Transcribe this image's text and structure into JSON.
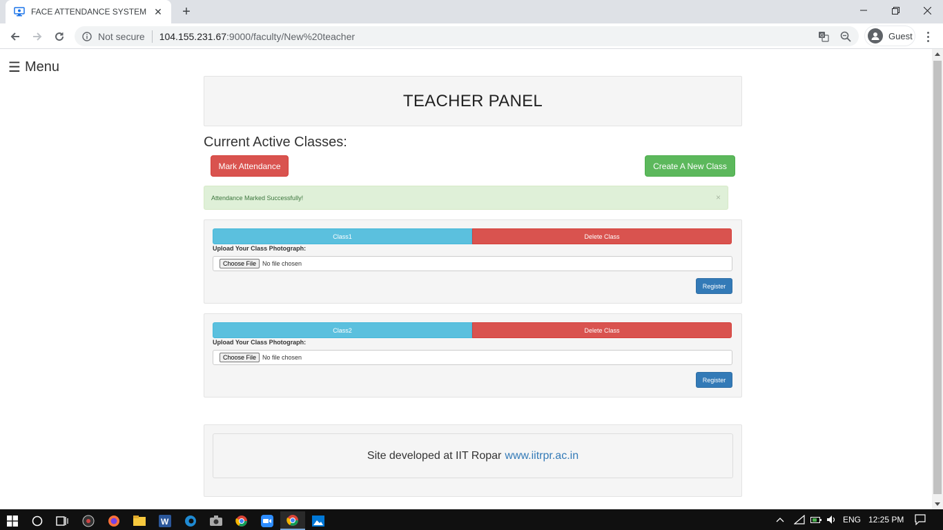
{
  "browser": {
    "tab_title": "FACE ATTENDANCE SYSTEM",
    "security_text": "Not secure",
    "url_host": "104.155.231.67",
    "url_path": ":9000/faculty/New%20teacher",
    "profile_label": "Guest"
  },
  "page": {
    "menu_label": "Menu",
    "panel_title": "TEACHER PANEL",
    "active_heading": "Current Active Classes:",
    "mark_attendance_label": "Mark Attendance",
    "create_class_label": "Create A New Class",
    "alert_message": "Attendance Marked Successfully!",
    "alert_close": "×",
    "classes": [
      {
        "name": "Class1",
        "delete_label": "Delete Class",
        "upload_label": "Upload Your Class Photograph:",
        "choose_label": "Choose File",
        "file_status": "No file chosen",
        "register_label": "Register"
      },
      {
        "name": "Class2",
        "delete_label": "Delete Class",
        "upload_label": "Upload Your Class Photograph:",
        "choose_label": "Choose File",
        "file_status": "No file chosen",
        "register_label": "Register"
      }
    ],
    "footer_text": "Site developed at IIT Ropar",
    "footer_link": "www.iitrpr.ac.in"
  },
  "taskbar": {
    "language": "ENG",
    "time": "12:25 PM"
  },
  "colors": {
    "danger": "#d9534f",
    "success": "#5cb85c",
    "info": "#5bc0de",
    "primary": "#337ab7",
    "alert_bg": "#dff0d8",
    "well_bg": "#f5f5f5"
  }
}
